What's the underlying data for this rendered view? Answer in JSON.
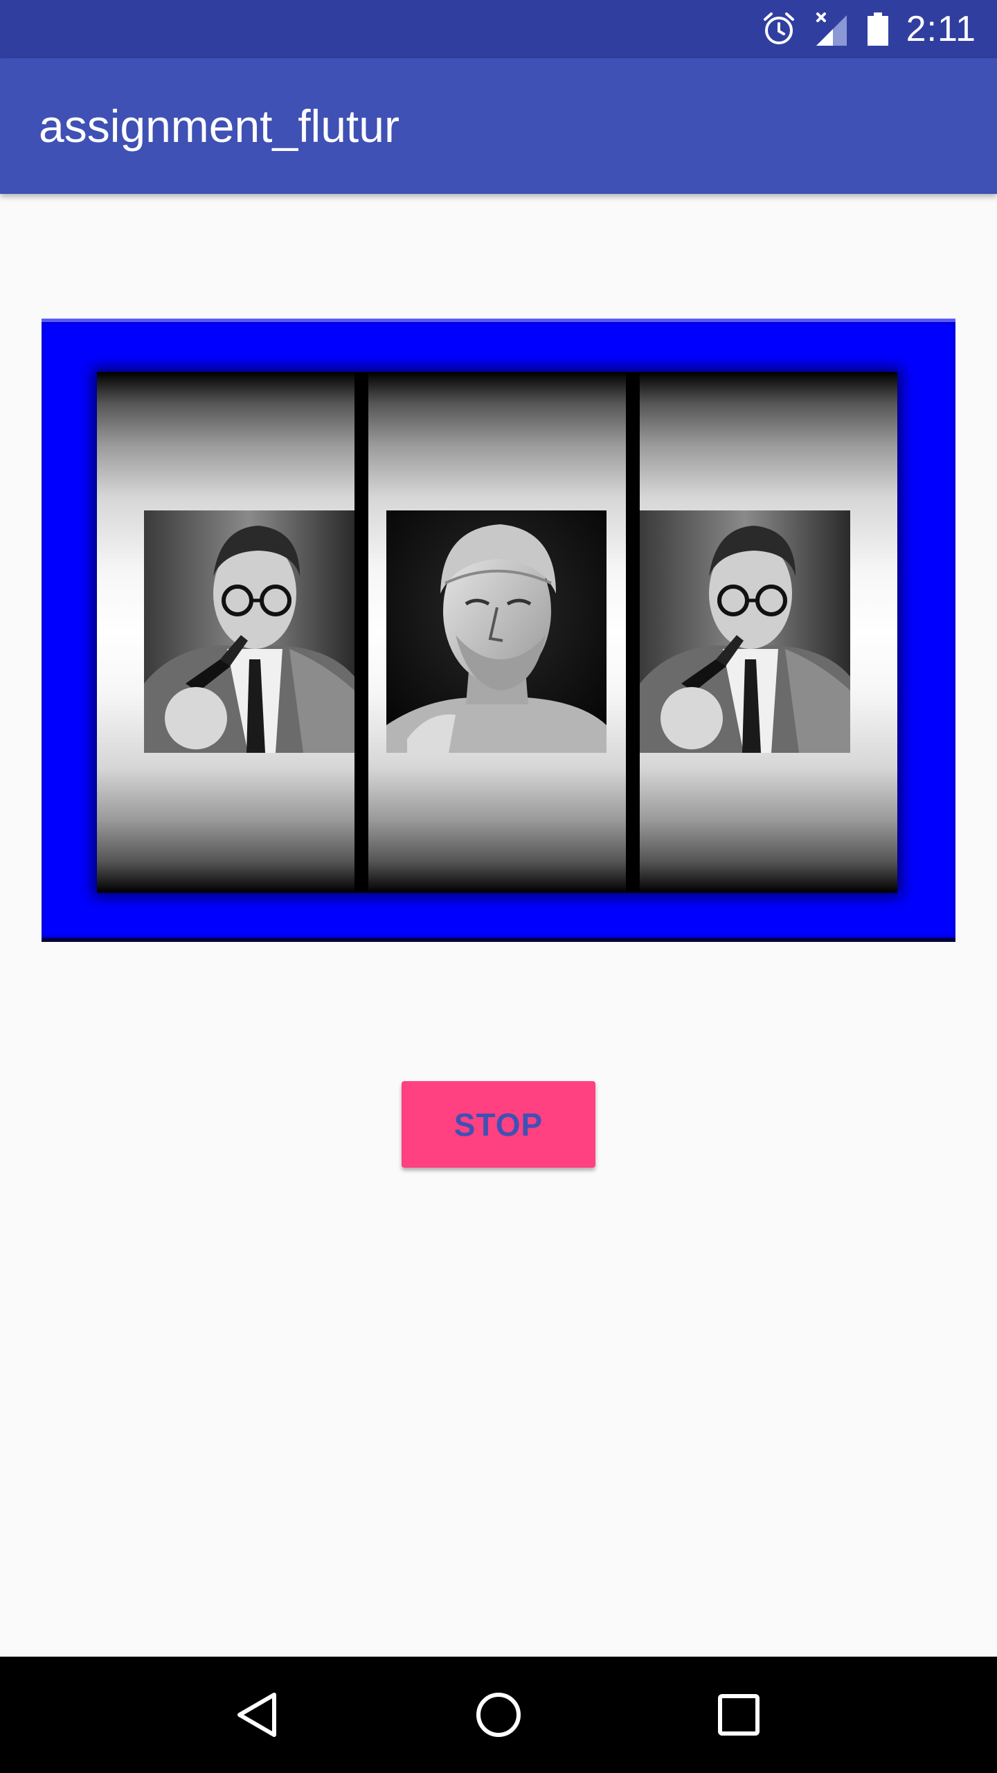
{
  "status_bar": {
    "time": "2:11",
    "icons": [
      "alarm-icon",
      "signal-no-data-icon",
      "battery-icon"
    ]
  },
  "app_bar": {
    "title": "assignment_flutur"
  },
  "slot_machine": {
    "frame_color": "#0000ff",
    "reels": [
      {
        "image": "man-with-pipe-portrait"
      },
      {
        "image": "bust-sculpture-portrait"
      },
      {
        "image": "man-with-pipe-portrait"
      }
    ]
  },
  "stop_button": {
    "label": "STOP",
    "background": "#ff4081",
    "text_color": "#3f51b5"
  },
  "nav_bar": {
    "buttons": [
      "back-icon",
      "home-icon",
      "recents-icon"
    ]
  },
  "theme": {
    "primary": "#3f51b5",
    "primary_dark": "#303f9f",
    "accent": "#ff4081",
    "background": "#fafafa"
  }
}
